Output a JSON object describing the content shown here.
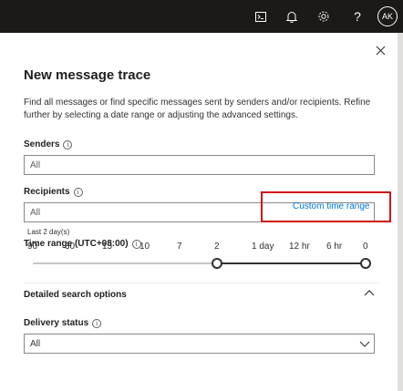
{
  "topbar": {
    "avatar_initials": "AK",
    "icons": [
      "terminal-icon",
      "bell-icon",
      "gear-icon",
      "help-icon"
    ]
  },
  "panel": {
    "title": "New message trace",
    "description": "Find all messages or find specific messages sent by senders and/or recipients. Refine further by selecting a date range or adjusting the advanced settings.",
    "senders": {
      "label": "Senders",
      "placeholder": "All"
    },
    "recipients": {
      "label": "Recipients",
      "placeholder": "All"
    },
    "time_range": {
      "label": "Time range (UTC+08:00)",
      "custom_link": "Custom time range",
      "selected_text": "Last 2 day(s)",
      "ticks": [
        "90",
        "30",
        "15",
        "10",
        "7",
        "2",
        "1 day",
        "12 hr",
        "6 hr",
        "0"
      ]
    },
    "detailed": {
      "heading": "Detailed search options"
    },
    "delivery_status": {
      "label": "Delivery status",
      "value": "All"
    }
  },
  "colors": {
    "topbar": "#1b1a19",
    "link": "#0078d4",
    "highlight": "#d0121b"
  }
}
